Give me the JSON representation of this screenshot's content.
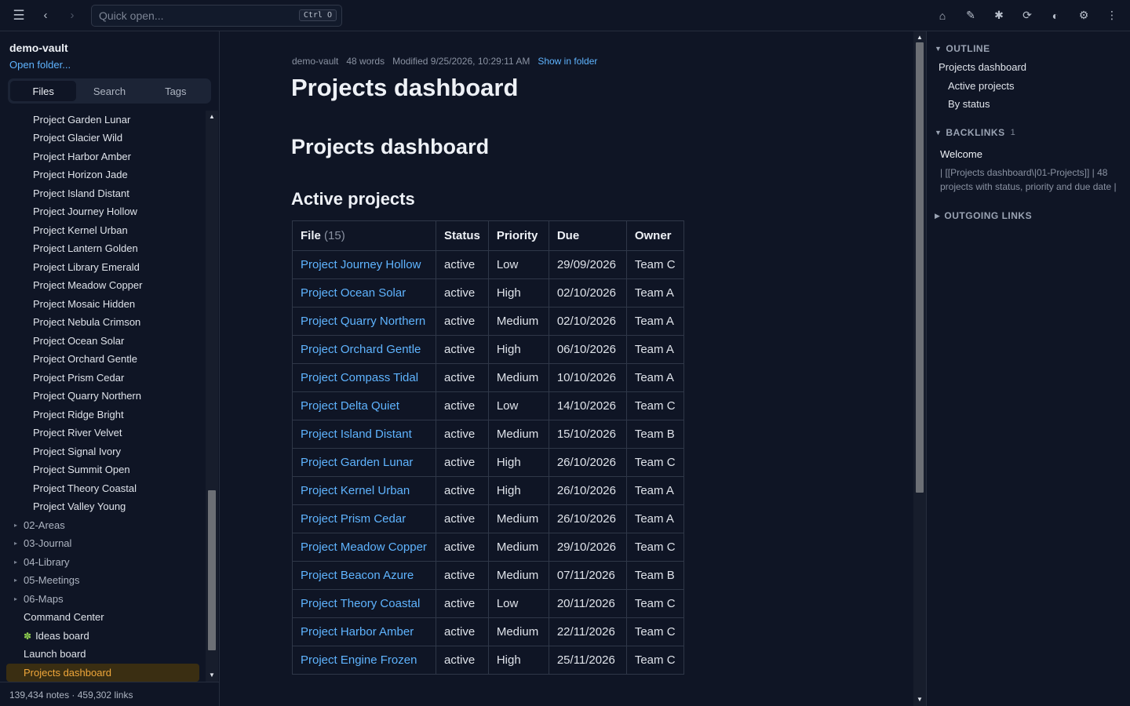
{
  "topbar": {
    "quick_open_placeholder": "Quick open...",
    "quick_open_shortcut": "Ctrl O",
    "icons": [
      "menu-icon",
      "back-icon",
      "forward-icon",
      "home-icon",
      "pen-icon",
      "asterisk-icon",
      "refresh-icon",
      "contrast-icon",
      "gear-icon",
      "more-icon"
    ]
  },
  "sidebar": {
    "vault_name": "demo-vault",
    "open_folder": "Open folder...",
    "tabs": [
      {
        "label": "Files",
        "active": true
      },
      {
        "label": "Search",
        "active": false
      },
      {
        "label": "Tags",
        "active": false
      }
    ],
    "files": [
      {
        "label": "Project Garden Lunar",
        "kind": "file",
        "level": 2
      },
      {
        "label": "Project Glacier Wild",
        "kind": "file",
        "level": 2
      },
      {
        "label": "Project Harbor Amber",
        "kind": "file",
        "level": 2
      },
      {
        "label": "Project Horizon Jade",
        "kind": "file",
        "level": 2
      },
      {
        "label": "Project Island Distant",
        "kind": "file",
        "level": 2
      },
      {
        "label": "Project Journey Hollow",
        "kind": "file",
        "level": 2
      },
      {
        "label": "Project Kernel Urban",
        "kind": "file",
        "level": 2
      },
      {
        "label": "Project Lantern Golden",
        "kind": "file",
        "level": 2
      },
      {
        "label": "Project Library Emerald",
        "kind": "file",
        "level": 2
      },
      {
        "label": "Project Meadow Copper",
        "kind": "file",
        "level": 2
      },
      {
        "label": "Project Mosaic Hidden",
        "kind": "file",
        "level": 2
      },
      {
        "label": "Project Nebula Crimson",
        "kind": "file",
        "level": 2
      },
      {
        "label": "Project Ocean Solar",
        "kind": "file",
        "level": 2
      },
      {
        "label": "Project Orchard Gentle",
        "kind": "file",
        "level": 2
      },
      {
        "label": "Project Prism Cedar",
        "kind": "file",
        "level": 2
      },
      {
        "label": "Project Quarry Northern",
        "kind": "file",
        "level": 2
      },
      {
        "label": "Project Ridge Bright",
        "kind": "file",
        "level": 2
      },
      {
        "label": "Project River Velvet",
        "kind": "file",
        "level": 2
      },
      {
        "label": "Project Signal Ivory",
        "kind": "file",
        "level": 2
      },
      {
        "label": "Project Summit Open",
        "kind": "file",
        "level": 2
      },
      {
        "label": "Project Theory Coastal",
        "kind": "file",
        "level": 2
      },
      {
        "label": "Project Valley Young",
        "kind": "file",
        "level": 2
      },
      {
        "label": "02-Areas",
        "kind": "folder",
        "level": 1
      },
      {
        "label": "03-Journal",
        "kind": "folder",
        "level": 1
      },
      {
        "label": "04-Library",
        "kind": "folder",
        "level": 1
      },
      {
        "label": "05-Meetings",
        "kind": "folder",
        "level": 1
      },
      {
        "label": "06-Maps",
        "kind": "folder",
        "level": 1
      },
      {
        "label": "Command Center",
        "kind": "file",
        "level": 1
      },
      {
        "label": "Ideas board",
        "kind": "file",
        "level": 1,
        "emoji": "✽"
      },
      {
        "label": "Launch board",
        "kind": "file",
        "level": 1
      },
      {
        "label": "Projects dashboard",
        "kind": "file",
        "level": 1,
        "selected": true
      }
    ],
    "status": "139,434 notes · 459,302 links"
  },
  "main": {
    "meta": {
      "vault": "demo-vault",
      "words": "48 words",
      "modified": "Modified 9/25/2026, 10:29:11 AM",
      "show_in_folder": "Show in folder"
    },
    "title": "Projects dashboard",
    "h1": "Projects dashboard",
    "h2": "Active projects",
    "table": {
      "headers": [
        "File",
        "Status",
        "Priority",
        "Due",
        "Owner"
      ],
      "file_count": "(15)",
      "rows": [
        [
          "Project Journey Hollow",
          "active",
          "Low",
          "29/09/2026",
          "Team C"
        ],
        [
          "Project Ocean Solar",
          "active",
          "High",
          "02/10/2026",
          "Team A"
        ],
        [
          "Project Quarry Northern",
          "active",
          "Medium",
          "02/10/2026",
          "Team A"
        ],
        [
          "Project Orchard Gentle",
          "active",
          "High",
          "06/10/2026",
          "Team A"
        ],
        [
          "Project Compass Tidal",
          "active",
          "Medium",
          "10/10/2026",
          "Team A"
        ],
        [
          "Project Delta Quiet",
          "active",
          "Low",
          "14/10/2026",
          "Team C"
        ],
        [
          "Project Island Distant",
          "active",
          "Medium",
          "15/10/2026",
          "Team B"
        ],
        [
          "Project Garden Lunar",
          "active",
          "High",
          "26/10/2026",
          "Team C"
        ],
        [
          "Project Kernel Urban",
          "active",
          "High",
          "26/10/2026",
          "Team A"
        ],
        [
          "Project Prism Cedar",
          "active",
          "Medium",
          "26/10/2026",
          "Team A"
        ],
        [
          "Project Meadow Copper",
          "active",
          "Medium",
          "29/10/2026",
          "Team C"
        ],
        [
          "Project Beacon Azure",
          "active",
          "Medium",
          "07/11/2026",
          "Team B"
        ],
        [
          "Project Theory Coastal",
          "active",
          "Low",
          "20/11/2026",
          "Team C"
        ],
        [
          "Project Harbor Amber",
          "active",
          "Medium",
          "22/11/2026",
          "Team C"
        ],
        [
          "Project Engine Frozen",
          "active",
          "High",
          "25/11/2026",
          "Team C"
        ]
      ]
    }
  },
  "rpanel": {
    "outline_title": "OUTLINE",
    "outline_items": [
      {
        "label": "Projects dashboard",
        "depth": 1
      },
      {
        "label": "Active projects",
        "depth": 2
      },
      {
        "label": "By status",
        "depth": 2
      }
    ],
    "backlinks_title": "BACKLINKS",
    "backlinks_count": "1",
    "backlink": {
      "title": "Welcome",
      "snippet": "| [[Projects dashboard\\|01-Projects]] | 48 projects with status, priority and due date |"
    },
    "outgoing_title": "OUTGOING LINKS"
  },
  "colors": {
    "background": "#0f1525",
    "accent_link": "#5fb4ff",
    "selected_bg": "#3a2e12",
    "selected_text": "#f0a73a"
  }
}
